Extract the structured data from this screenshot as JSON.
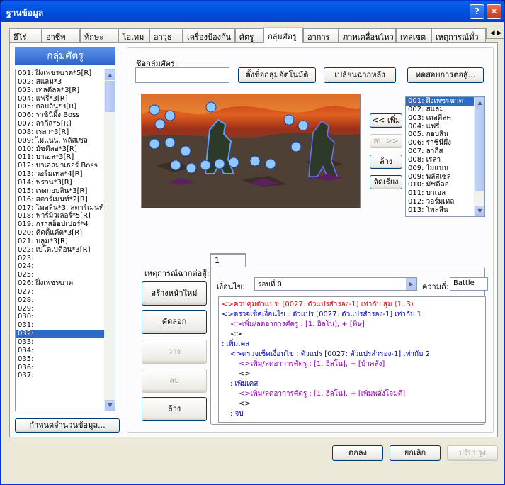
{
  "window": {
    "title": "ฐานข้อมูล"
  },
  "tabs": [
    "ฮีโร่",
    "อาชีพ",
    "ทักษะ",
    "ไอเทม",
    "อาวุธ",
    "เครื่องป้องกัน",
    "ศัตรู",
    "กลุ่มศัตรู",
    "อาการ",
    "ภาพเคลื่อนไหว",
    "เทลเซต",
    "เหตุการณ์ทั่ว"
  ],
  "left": {
    "header": "กลุ่มศัตรู",
    "items": [
      "001: ฝิ่งเพชรฆาต*5[R]",
      "002: สแลม*3",
      "003: เทลตีลค*3[R]",
      "004: แฟรี่*3[R]",
      "005: กอบลิน*3[R]",
      "006: ราชินีผึ้ง Boss",
      "007: ลากีส*5[R]",
      "008: เรลา*3[R]",
      "009: ไมแนน, พลัสเซล",
      "010: มัซตีลอ*3[R]",
      "011: บาเอล*3[R]",
      "012: บาเอลมาเธอร์ Boss",
      "013: วอร์มเทล*4[R]",
      "014: ฟราน*3[R]",
      "015: เรดกอบลิน*3[R]",
      "016: สตาร์เมนท์*2[R]",
      "017: โพลลีน*3, สตาร์เมนท์[",
      "018: ฟาร์มิวเลอร์*5[R]",
      "019: กราสฮ็อปเปอร์*4",
      "020: คิดดี้แค๊ต*3[R]",
      "021: บลูม*3[R]",
      "022: เบโตเบดีอน*3[R]",
      "023:",
      "024:",
      "025:",
      "026: ฝิ่งเพชรฆาต",
      "027:",
      "028:",
      "029:",
      "030:",
      "031:",
      "032:",
      "033:",
      "034:",
      "035:",
      "036:",
      "037:"
    ],
    "selected_index": 31,
    "max_button": "กำหนดจำนวนข้อมูล..."
  },
  "name": {
    "label": "ชื่อกลุ่มศัตรู:",
    "value": ""
  },
  "top_buttons": {
    "auto_name": "ตั้งชื่อกลุ่มอัตโนมัติ",
    "change_bg": "เปลี่ยนฉากหลัง",
    "battle_test": "ทดสอบการต่อสู้..."
  },
  "mid_buttons": {
    "add": "<< เพิ่ม",
    "remove": "ลบ >>",
    "clear": "ล้าง",
    "arrange": "จัดเรียง"
  },
  "enemy_list": {
    "items": [
      "001: ฝิ่งเพชรฆาต",
      "002: สแลม",
      "003: เทลตีลค",
      "004: แฟรี่",
      "005: กอบลิน",
      "006: ราชินีผึ้ง",
      "007: ลากีส",
      "008: เรลา",
      "009: ไมแนน",
      "009: พลัสเซล",
      "010: มัซตีลอ",
      "011: บาเอล",
      "012: วอร์มเทล",
      "013: โพลลีน"
    ],
    "selected_index": 0
  },
  "events": {
    "label": "เหตุการณ์ฉากต่อสู้:",
    "new_page": "สร้างหน้าใหม่",
    "copy": "คัดลอก",
    "paste": "วาง",
    "delete": "ลบ",
    "clear": "ล้าง",
    "page_tab": "1",
    "condition_label": "เงื่อนไข:",
    "condition_value": "รอบที่ 0",
    "span_label": "ความถี่:",
    "span_value": "Battle",
    "lines": [
      {
        "text": "<>ควบคุมตัวแปร: [0027: ตัวแปรสำรอง-1] เท่ากับ สุ่ม (1..3)",
        "cls": "c-red",
        "indent": 0
      },
      {
        "text": "<>ตรวจเช็คเงื่อนไข : ตัวแปร [0027: ตัวแปรสำรอง-1] เท่ากับ 1",
        "cls": "c-blue",
        "indent": 0
      },
      {
        "text": "<>เพิ่ม/ลดอาการศัตรู : [1. ฮิลโน], + [พิษ]",
        "cls": "c-purp",
        "indent": 1
      },
      {
        "text": "<>",
        "cls": "",
        "indent": 1
      },
      {
        "text": ":  เพิ่มเคส",
        "cls": "c-blue",
        "indent": 0
      },
      {
        "text": "<>ตรวจเช็คเงื่อนไข : ตัวแปร [0027: ตัวแปรสำรอง-1] เท่ากับ 2",
        "cls": "c-blue",
        "indent": 1
      },
      {
        "text": "<>เพิ่ม/ลดอาการศัตรู : [1. ฮิลโน], + [บ้าคลั่ง]",
        "cls": "c-purp",
        "indent": 2
      },
      {
        "text": "<>",
        "cls": "",
        "indent": 2
      },
      {
        "text": ":  เพิ่มเคส",
        "cls": "c-blue",
        "indent": 1
      },
      {
        "text": "<>เพิ่ม/ลดอาการศัตรู : [1. ฮิลโน], + [เพิ่มพลังโจมตี]",
        "cls": "c-purp",
        "indent": 2
      },
      {
        "text": "<>",
        "cls": "",
        "indent": 2
      },
      {
        "text": ":  จบ",
        "cls": "c-blue",
        "indent": 1
      }
    ]
  },
  "bottom": {
    "ok": "ตกลง",
    "cancel": "ยกเลิก",
    "apply": "ปรับปรุง"
  },
  "colors": {
    "title_bar": "#0054e3",
    "selection": "#316ac5"
  }
}
